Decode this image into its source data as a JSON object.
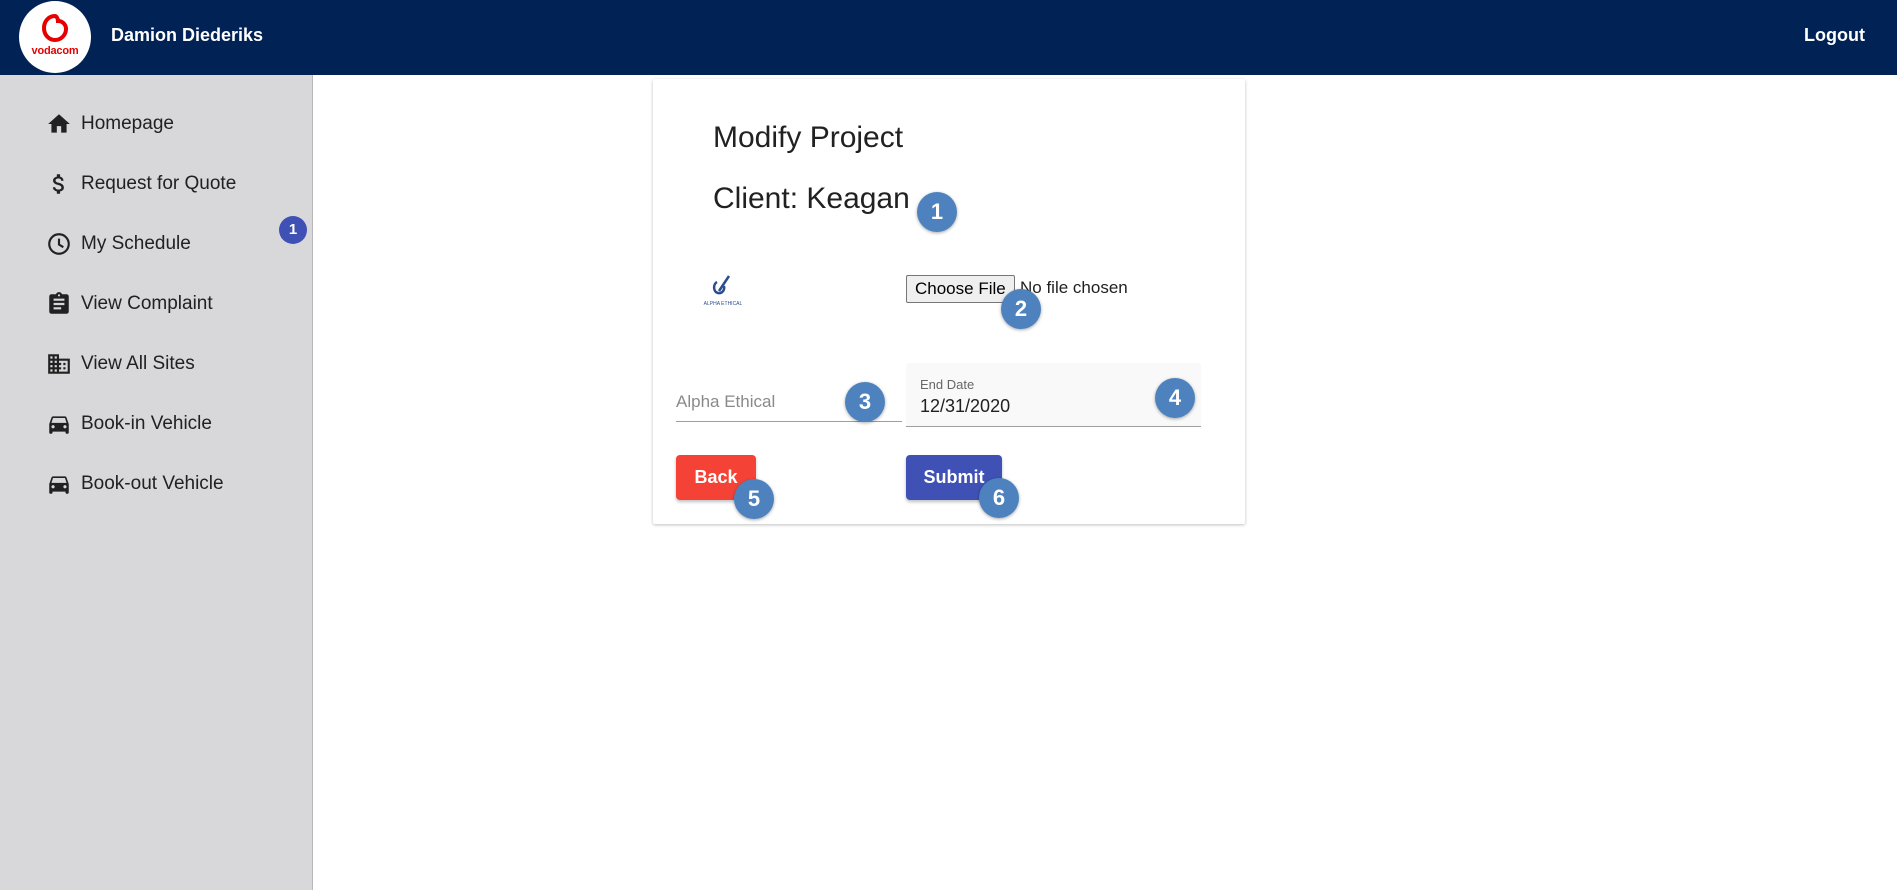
{
  "header": {
    "logo_text": "vodacom",
    "username": "Damion Diederiks",
    "logout_label": "Logout"
  },
  "sidebar": {
    "badge": "1",
    "items": [
      {
        "label": "Homepage",
        "icon": "home-icon"
      },
      {
        "label": "Request for Quote",
        "icon": "dollar-icon"
      },
      {
        "label": "My Schedule",
        "icon": "clock-icon"
      },
      {
        "label": "View Complaint",
        "icon": "clipboard-icon"
      },
      {
        "label": "View All Sites",
        "icon": "building-icon"
      },
      {
        "label": "Book-in Vehicle",
        "icon": "car-icon"
      },
      {
        "label": "Book-out Vehicle",
        "icon": "car-icon"
      }
    ]
  },
  "form": {
    "title": "Modify Project",
    "client": "Client: Keagan",
    "thumbnail_text": "ALPHA ETHICAL",
    "file_button": "Choose File",
    "file_status": "No file chosen",
    "name_placeholder": "Alpha Ethical",
    "end_date_label": "End Date",
    "end_date_value": "12/31/2020",
    "back_label": "Back",
    "submit_label": "Submit"
  },
  "markers": [
    "1",
    "2",
    "3",
    "4",
    "5",
    "6"
  ],
  "colors": {
    "header_bg": "#002255",
    "sidebar_bg": "#d8d8db",
    "back_button": "#f44336",
    "submit_button": "#3f51b5",
    "marker": "#4d82bf",
    "brand_red": "#e60000"
  }
}
